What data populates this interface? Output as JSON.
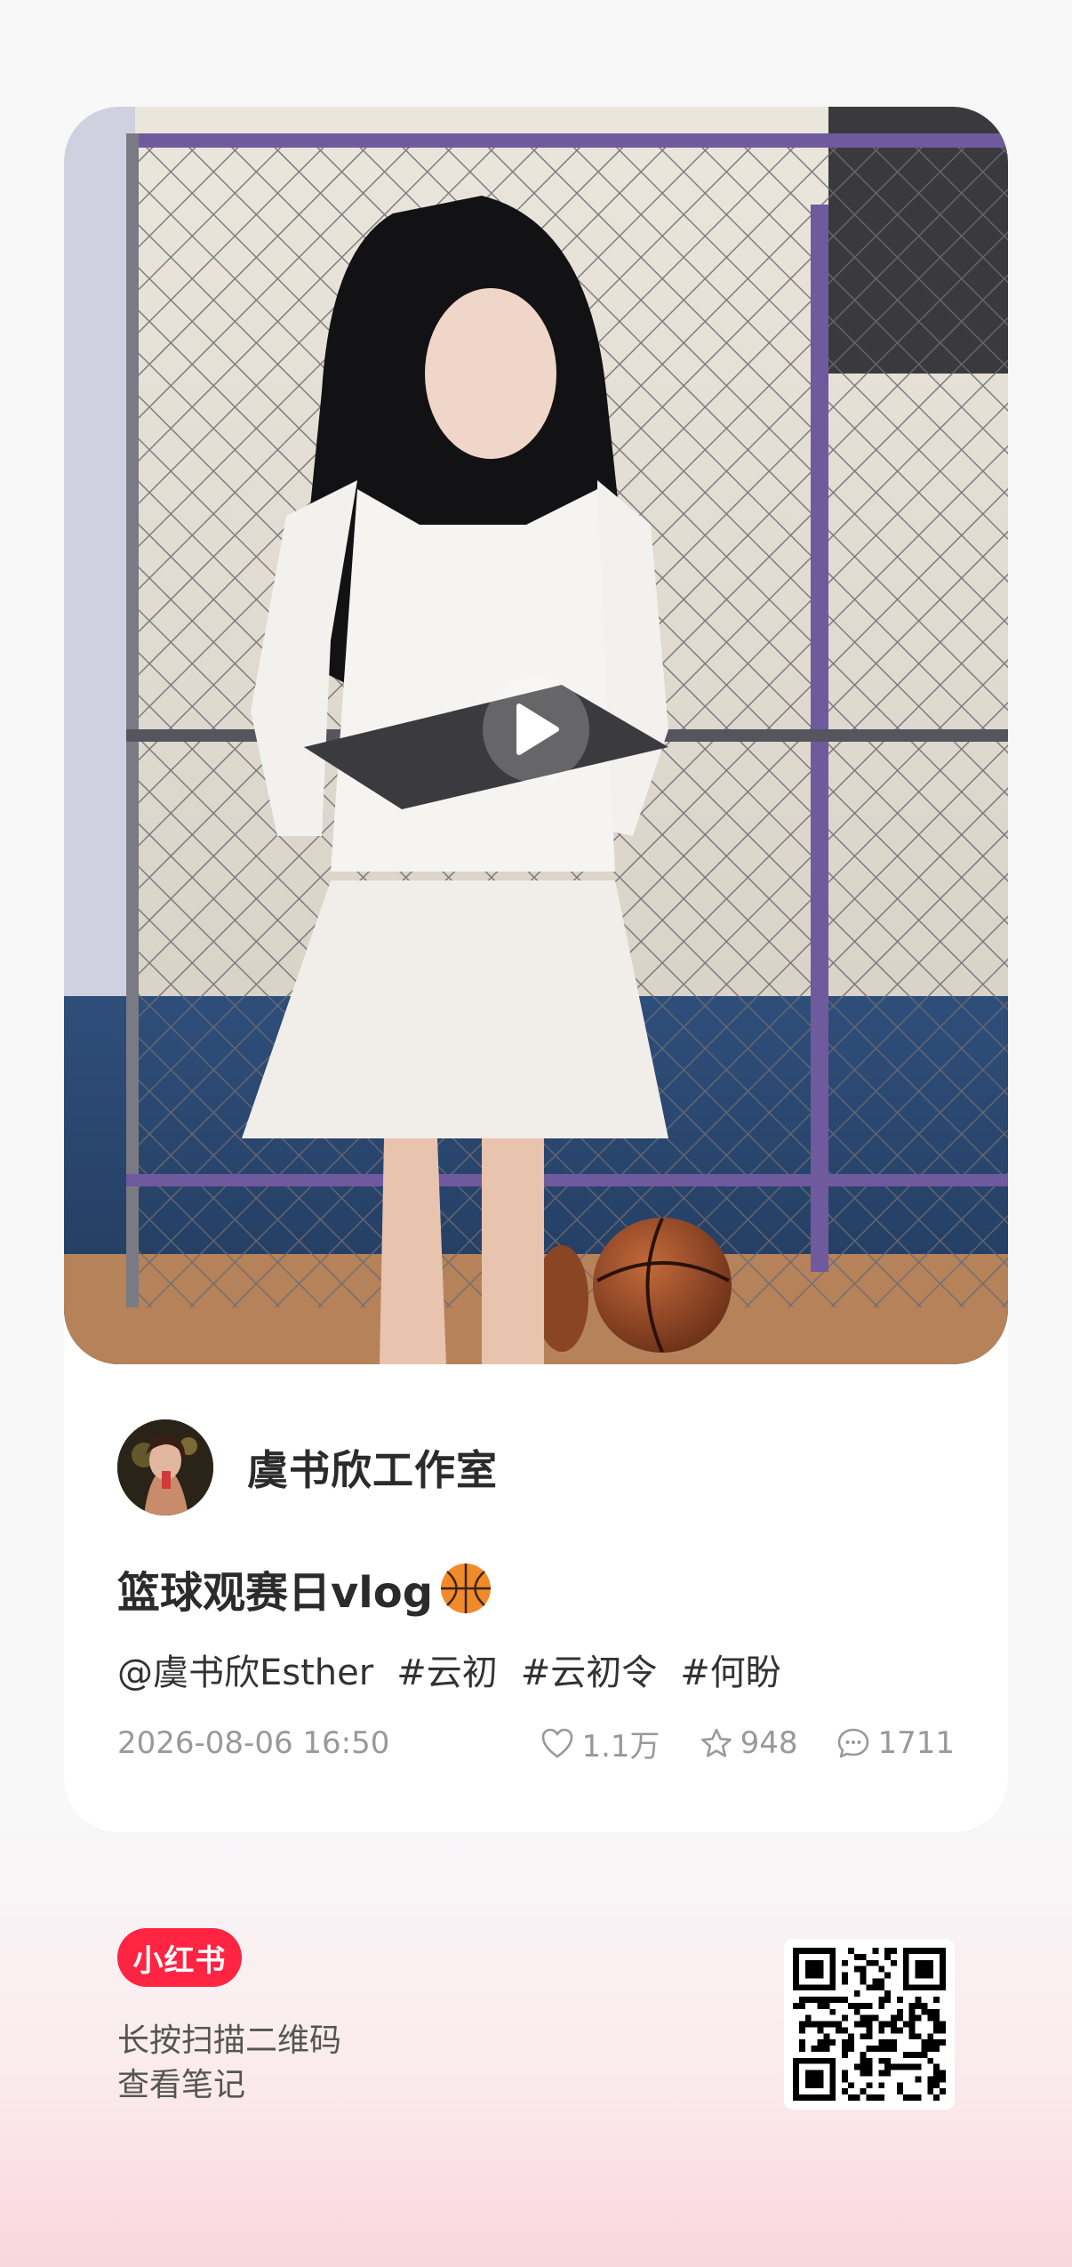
{
  "post": {
    "author_name": "虞书欣工作室",
    "title": "篮球观赛日vlog",
    "title_emoji": "basketball-icon",
    "tags": [
      "@虞书欣Esther",
      "#云初",
      "#云初令",
      "#何盼"
    ],
    "datetime": "2026-08-06 16:50",
    "likes": "1.1万",
    "collects": "948",
    "comments": "1711"
  },
  "footer": {
    "brand": "小红书",
    "hint_line1": "长按扫描二维码",
    "hint_line2": "查看笔记"
  },
  "colors": {
    "brand_red": "#ff2442",
    "meta_gray": "#999999",
    "text_dark": "#2b2b2b"
  }
}
